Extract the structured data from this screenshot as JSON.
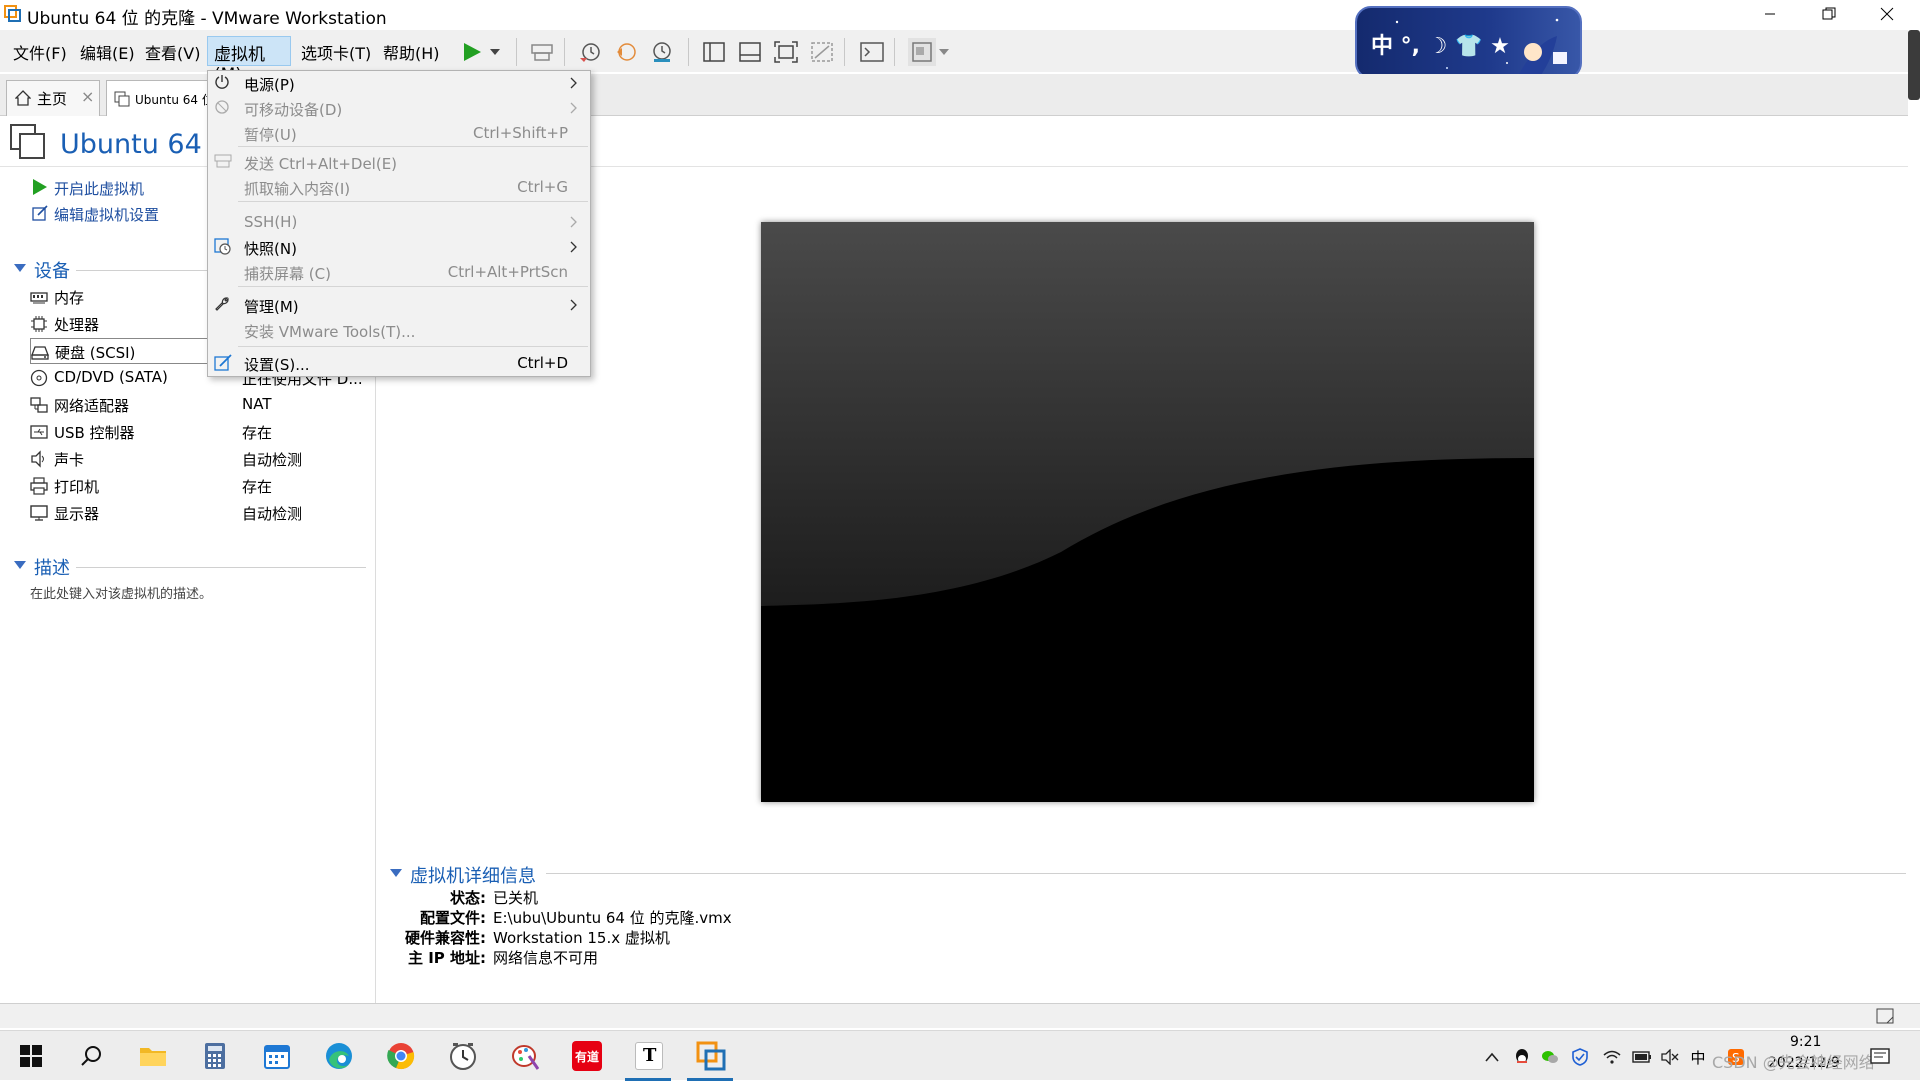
{
  "window": {
    "title": "Ubuntu 64 位 的克隆 - VMware Workstation",
    "minimize": "minimize-icon",
    "maximize": "restore-icon",
    "close": "close-icon"
  },
  "menubar": {
    "items": [
      "文件(F)",
      "编辑(E)",
      "查看(V)",
      "虚拟机(M)",
      "选项卡(T)",
      "帮助(H)"
    ],
    "active": "虚拟机(M)"
  },
  "ime": {
    "text": "中 °, ☽ 👕 ★"
  },
  "tabs": [
    {
      "label": "主页",
      "close": "×"
    },
    {
      "label": "Ubuntu 64 位"
    }
  ],
  "vm": {
    "title": "Ubuntu 64 位",
    "actions": [
      "开启此虚拟机",
      "编辑虚拟机设置"
    ]
  },
  "devices": {
    "section": "设备",
    "items": [
      {
        "name": "内存",
        "value": "",
        "icon": "memory-icon"
      },
      {
        "name": "处理器",
        "value": "",
        "icon": "cpu-icon"
      },
      {
        "name": "硬盘 (SCSI)",
        "value": "",
        "icon": "harddisk-icon"
      },
      {
        "name": "CD/DVD (SATA)",
        "value": "正在使用文件 D...",
        "icon": "cd-icon"
      },
      {
        "name": "网络适配器",
        "value": "NAT",
        "icon": "network-icon"
      },
      {
        "name": "USB 控制器",
        "value": "存在",
        "icon": "usb-icon"
      },
      {
        "name": "声卡",
        "value": "自动检测",
        "icon": "sound-icon"
      },
      {
        "name": "打印机",
        "value": "存在",
        "icon": "printer-icon"
      },
      {
        "name": "显示器",
        "value": "自动检测",
        "icon": "monitor-icon"
      }
    ]
  },
  "description": {
    "section": "描述",
    "placeholder": "在此处键入对该虚拟机的描述。"
  },
  "details": {
    "section": "虚拟机详细信息",
    "rows": [
      {
        "label": "状态:",
        "value": "已关机"
      },
      {
        "label": "配置文件:",
        "value": "E:\\ubu\\Ubuntu 64 位 的克隆.vmx"
      },
      {
        "label": "硬件兼容性:",
        "value": "Workstation 15.x 虚拟机"
      },
      {
        "label": "主 IP 地址:",
        "value": "网络信息不可用"
      }
    ]
  },
  "dropdown": {
    "items": [
      {
        "label": "电源(P)",
        "shortcut": "",
        "submenu": true,
        "disabled": false
      },
      {
        "label": "可移动设备(D)",
        "shortcut": "",
        "submenu": true,
        "disabled": true
      },
      {
        "label": "暂停(U)",
        "shortcut": "Ctrl+Shift+P",
        "submenu": false,
        "disabled": true
      },
      {
        "label": "发送 Ctrl+Alt+Del(E)",
        "shortcut": "",
        "submenu": false,
        "disabled": true
      },
      {
        "label": "抓取输入内容(I)",
        "shortcut": "Ctrl+G",
        "submenu": false,
        "disabled": true
      },
      {
        "label": "SSH(H)",
        "shortcut": "",
        "submenu": true,
        "disabled": true
      },
      {
        "label": "快照(N)",
        "shortcut": "",
        "submenu": true,
        "disabled": false
      },
      {
        "label": "捕获屏幕 (C)",
        "shortcut": "Ctrl+Alt+PrtScn",
        "submenu": false,
        "disabled": true
      },
      {
        "label": "管理(M)",
        "shortcut": "",
        "submenu": true,
        "disabled": false
      },
      {
        "label": "安装 VMware Tools(T)...",
        "shortcut": "",
        "submenu": false,
        "disabled": true
      },
      {
        "label": "设置(S)...",
        "shortcut": "Ctrl+D",
        "submenu": false,
        "disabled": false
      }
    ]
  },
  "taskbar": {
    "apps": [
      "start-icon",
      "search-icon",
      "file-explorer-icon",
      "calculator-icon",
      "calendar-icon",
      "edge-icon",
      "chrome-icon",
      "clock-app-icon",
      "paint-icon",
      "youdao-icon",
      "typora-icon",
      "vmware-icon"
    ],
    "youdao_label": "有道",
    "typora_label": "T",
    "ime_indicator": "中",
    "time": "9:21",
    "date": "2022/12/9",
    "watermark": "CSDN @先会神经网络"
  },
  "colors": {
    "accent": "#1a5fb4",
    "menu_highlight": "#cce4f7",
    "play_green": "#22a022"
  }
}
